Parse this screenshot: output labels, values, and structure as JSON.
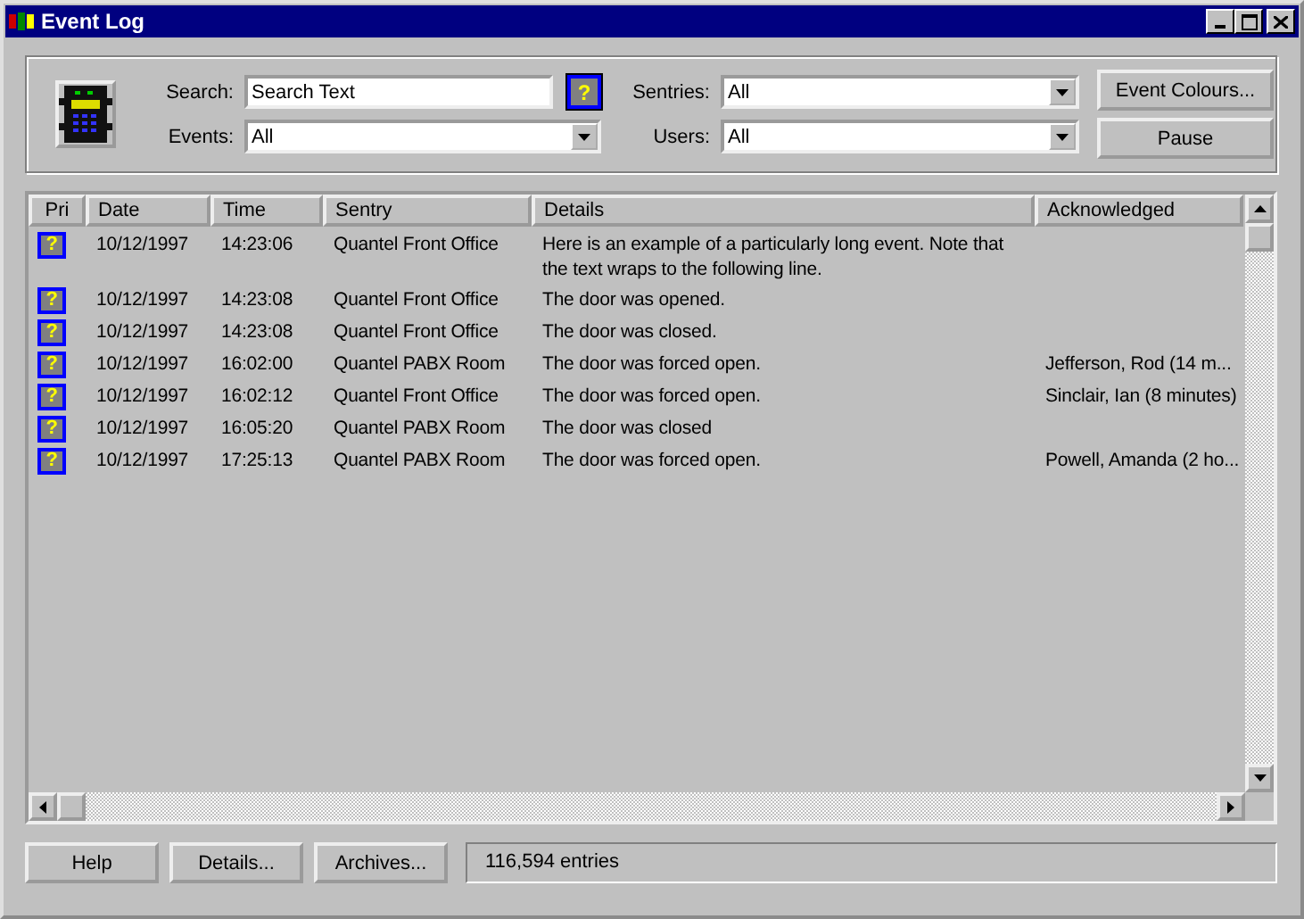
{
  "window": {
    "title": "Event Log"
  },
  "filters": {
    "search_label": "Search:",
    "search_value": "Search Text",
    "help_button": "?",
    "events_label": "Events:",
    "events_value": "All",
    "sentries_label": "Sentries:",
    "sentries_value": "All",
    "users_label": "Users:",
    "users_value": "All"
  },
  "side_buttons": [
    "Event Colours...",
    "Pause"
  ],
  "table": {
    "columns": [
      "Pri",
      "Date",
      "Time",
      "Sentry",
      "Details",
      "Acknowledged"
    ],
    "rows": [
      {
        "pri": "?",
        "date": "10/12/1997",
        "time": "14:23:06",
        "sentry": "Quantel Front Office",
        "details": "Here is an example of a particularly long event.  Note that the text wraps to the following line."
      },
      {
        "pri": "?",
        "date": "10/12/1997",
        "time": "14:23:08",
        "sentry": "Quantel Front Office",
        "details": "The door was opened."
      },
      {
        "pri": "?",
        "date": "10/12/1997",
        "time": "14:23:08",
        "sentry": "Quantel Front Office",
        "details": "The door was closed."
      },
      {
        "pri": "?",
        "date": "10/12/1997",
        "time": "16:02:00",
        "sentry": "Quantel PABX Room",
        "details": "The door was forced open.",
        "acknowledged": "Jefferson, Rod (14 m..."
      },
      {
        "pri": "?",
        "date": "10/12/1997",
        "time": "16:02:12",
        "sentry": "Quantel Front Office",
        "details": "The door was forced open.",
        "acknowledged": "Sinclair, Ian (8 minutes)"
      },
      {
        "pri": "?",
        "date": "10/12/1997",
        "time": "16:05:20",
        "sentry": "Quantel PABX Room",
        "details": "The door was closed"
      },
      {
        "pri": "?",
        "date": "10/12/1997",
        "time": "17:25:13",
        "sentry": "Quantel PABX Room",
        "details": "The door was forced open.",
        "acknowledged": "Powell, Amanda (2 ho..."
      }
    ]
  },
  "bottom_buttons": [
    "Help",
    "Details...",
    "Archives..."
  ],
  "status": "116,594 entries"
}
